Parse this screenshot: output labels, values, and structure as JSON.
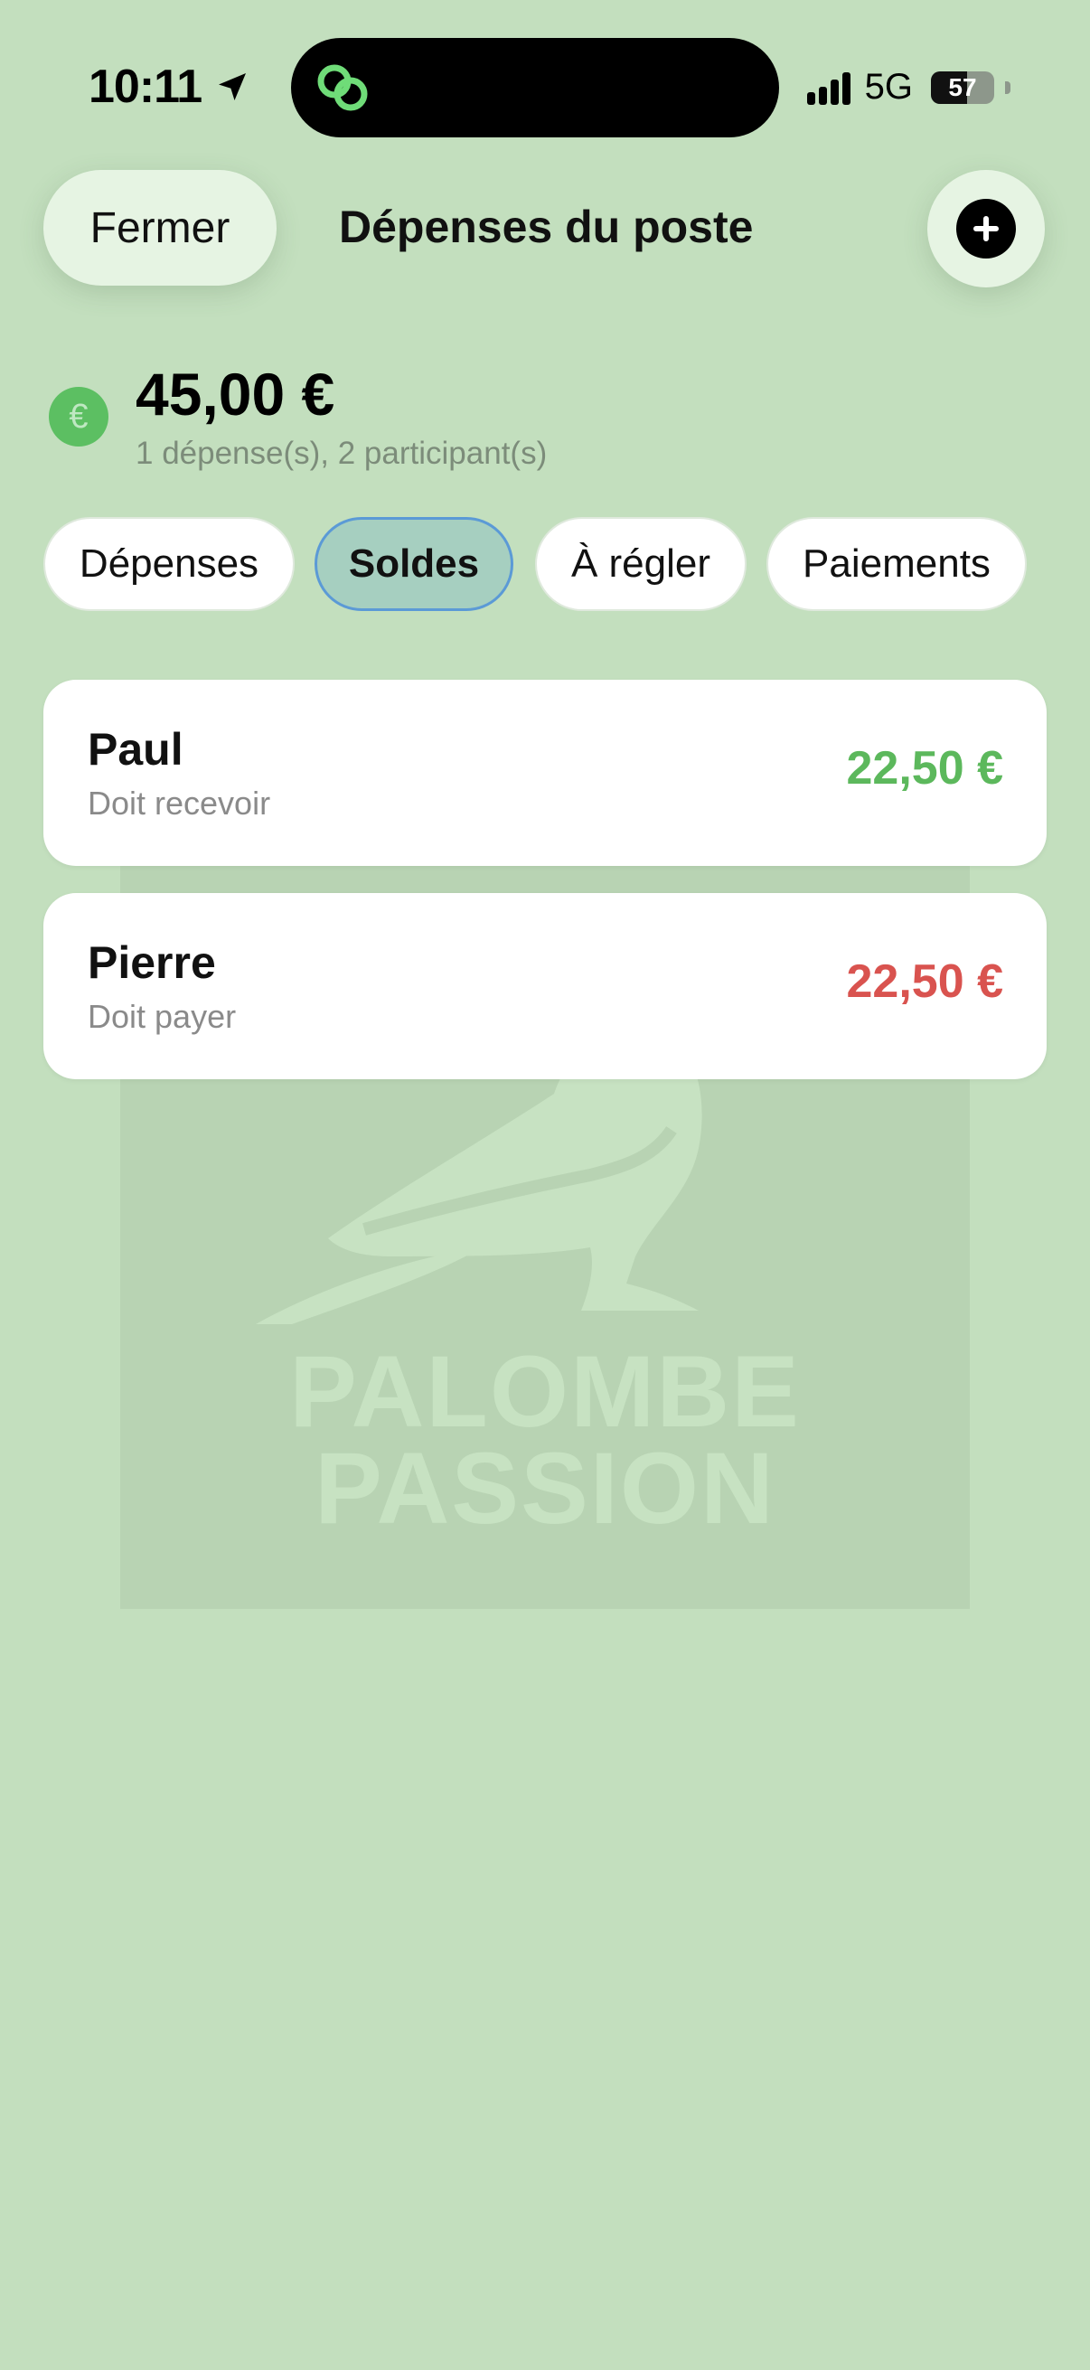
{
  "status_bar": {
    "time": "10:11",
    "network": "5G",
    "battery": "57",
    "battery_level": 0.57
  },
  "header": {
    "close_label": "Fermer",
    "title": "Dépenses du poste",
    "add_icon": "plus-icon"
  },
  "summary": {
    "currency_symbol": "€",
    "total": "45,00 €",
    "subtitle": "1 dépense(s), 2 participant(s)"
  },
  "tabs": [
    {
      "label": "Dépenses",
      "active": false
    },
    {
      "label": "Soldes",
      "active": true
    },
    {
      "label": "À régler",
      "active": false
    },
    {
      "label": "Paiements",
      "active": false
    }
  ],
  "balances": [
    {
      "name": "Paul",
      "status": "Doit recevoir",
      "amount": "22,50 €",
      "color": "#5cb85c"
    },
    {
      "name": "Pierre",
      "status": "Doit payer",
      "amount": "22,50 €",
      "color": "#d9534f"
    }
  ],
  "watermark": {
    "line1": "PALOMBE",
    "line2": "PASSION"
  },
  "colors": {
    "background": "#c3dfbe",
    "accent_green": "#5cbf62",
    "positive": "#5cb85c",
    "negative": "#d9534f",
    "active_tab_border": "#5b9ad6"
  }
}
